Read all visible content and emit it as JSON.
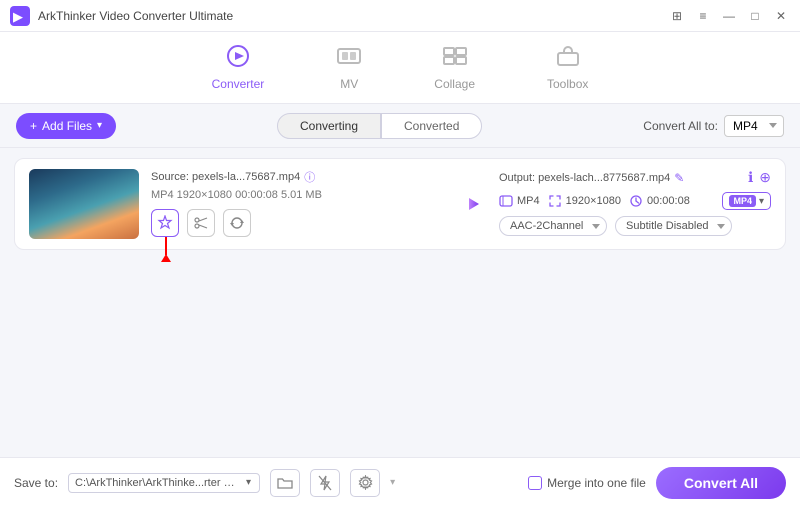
{
  "app": {
    "title": "ArkThinker Video Converter Ultimate"
  },
  "titlebar": {
    "controls": {
      "grid": "⊞",
      "menu": "≡",
      "minimize": "—",
      "maximize": "□",
      "close": "✕"
    }
  },
  "nav": {
    "items": [
      {
        "id": "converter",
        "label": "Converter",
        "active": true
      },
      {
        "id": "mv",
        "label": "MV",
        "active": false
      },
      {
        "id": "collage",
        "label": "Collage",
        "active": false
      },
      {
        "id": "toolbox",
        "label": "Toolbox",
        "active": false
      }
    ]
  },
  "toolbar": {
    "add_files": "Add Files",
    "tabs": [
      {
        "id": "converting",
        "label": "Converting",
        "active": true
      },
      {
        "id": "converted",
        "label": "Converted",
        "active": false
      }
    ],
    "convert_all_to": "Convert All to:",
    "format": "MP4"
  },
  "file_item": {
    "source_label": "Source: pexels-la...75687.mp4",
    "meta": "MP4   1920×1080   00:00:08   5.01 MB",
    "output_label": "Output: pexels-lach...8775687.mp4",
    "output_format": "MP4",
    "output_resolution": "1920×1080",
    "output_duration": "00:00:08",
    "output_audio": "AAC-2Channel",
    "output_subtitle": "Subtitle Disabled",
    "format_badge": "MP4"
  },
  "bottom": {
    "save_to": "Save to:",
    "save_path": "C:\\ArkThinker\\ArkThinke...rter Ultimate\\Converted",
    "merge_label": "Merge into one file",
    "convert_btn": "Convert All"
  },
  "icons": {
    "plus": "+",
    "chevron_down": "▾",
    "arrow_right": "→",
    "star": "✦",
    "scissors": "✂",
    "sync": "↻",
    "info": "ⓘ",
    "edit": "✎",
    "info2": "ℹ",
    "plus2": "⊕",
    "folder": "📁",
    "settings": "⚙",
    "flash_off": "⚡",
    "flash_on": "⚡"
  }
}
